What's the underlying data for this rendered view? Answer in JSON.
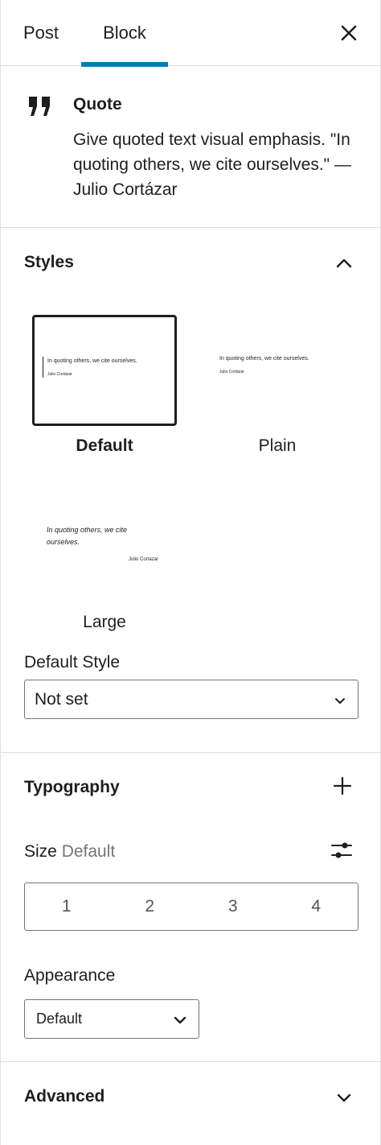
{
  "tabs": {
    "post": "Post",
    "block": "Block"
  },
  "block": {
    "title": "Quote",
    "description": "Give quoted text visual emphasis. \"In quoting others, we cite ourselves.\" — Julio Cortázar"
  },
  "styles": {
    "heading": "Styles",
    "preview_quote": "In quoting others, we cite ourselves.",
    "preview_quote_large_line1": "In quoting others, we cite",
    "preview_quote_large_line2": "ourselves.",
    "preview_cite": "Julio Cortázar",
    "items": [
      {
        "label": "Default",
        "selected": true
      },
      {
        "label": "Plain",
        "selected": false
      },
      {
        "label": "Large",
        "selected": false
      }
    ],
    "default_style_label": "Default Style",
    "default_style_value": "Not set"
  },
  "typography": {
    "heading": "Typography",
    "size_label": "Size",
    "size_value": "Default",
    "size_options": [
      "1",
      "2",
      "3",
      "4"
    ],
    "appearance_label": "Appearance",
    "appearance_value": "Default"
  },
  "advanced": {
    "heading": "Advanced"
  },
  "colors": {
    "accent": "#007cba",
    "text": "#1e1e1e",
    "muted": "#757575",
    "border": "#dcdcdc"
  }
}
